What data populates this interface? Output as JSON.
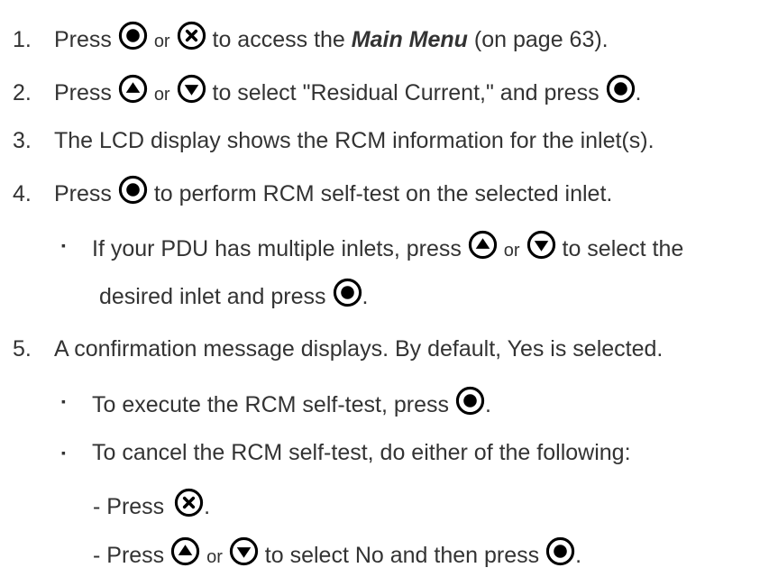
{
  "steps": [
    {
      "num": "1.",
      "press": "Press",
      "or": "or",
      "text_a": "to access the",
      "link": "Main Menu",
      "text_b": "(on page 63)."
    },
    {
      "num": "2.",
      "press": "Press",
      "or": "or",
      "text_a": "to select \"Residual Current,\" and press",
      "end": "."
    },
    {
      "num": "3.",
      "text": "The LCD display shows the RCM information for the inlet(s)."
    },
    {
      "num": "4.",
      "press": "Press",
      "text_a": "to perform RCM self-test on the selected inlet."
    },
    {
      "num": "5.",
      "text": "A confirmation message displays. By default, Yes is selected."
    }
  ],
  "bullets": {
    "multiple_inlets": {
      "text_a": "If your PDU has multiple inlets, press",
      "or": "or",
      "text_b": "to select the",
      "text_c": "desired inlet and press",
      "end": "."
    },
    "execute": {
      "text_a": "To execute the RCM self-test, press",
      "end": "."
    },
    "cancel": {
      "text": "To cancel the RCM self-test, do either of the following:"
    }
  },
  "sub_items": {
    "press_x": {
      "prefix": "- Press",
      "end": "."
    },
    "press_arrows": {
      "prefix": "- Press",
      "or": "or",
      "text_a": "to select No and then press",
      "end": "."
    }
  },
  "icons": [
    "ok-button-icon",
    "cancel-x-button-icon",
    "up-arrow-button-icon",
    "down-arrow-button-icon"
  ]
}
